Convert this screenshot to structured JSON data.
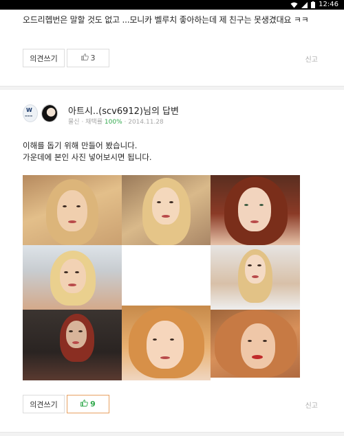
{
  "status_bar": {
    "time": "12:46"
  },
  "previous_answer": {
    "text": "오드리헵번은 말할 것도 없고 ...모니카 벨루치 좋아하는데 제 친구는 못생겼대요 ㅋㅋ",
    "comment_label": "의견쓰기",
    "like_count": "3",
    "report_label": "신고"
  },
  "answer": {
    "author": "아트시..(scv6912)님의 답변",
    "meta_rank": "물신",
    "meta_selection_label": "채택률",
    "meta_selection_rate": "100%",
    "meta_date": "2014.11.28",
    "body_lines": [
      "이해를 돕기 위해 만들어 봤습니다.",
      "가운데에 본인 사진 넣어보시면 됩니다."
    ],
    "badge_icon": "wing-badge-icon",
    "comment_label": "의견쓰기",
    "like_count": "9",
    "report_label": "신고"
  },
  "colors": {
    "like_green": "#2fa84a",
    "active_border": "#e8a060",
    "meta_gray": "#a6a6a6"
  }
}
